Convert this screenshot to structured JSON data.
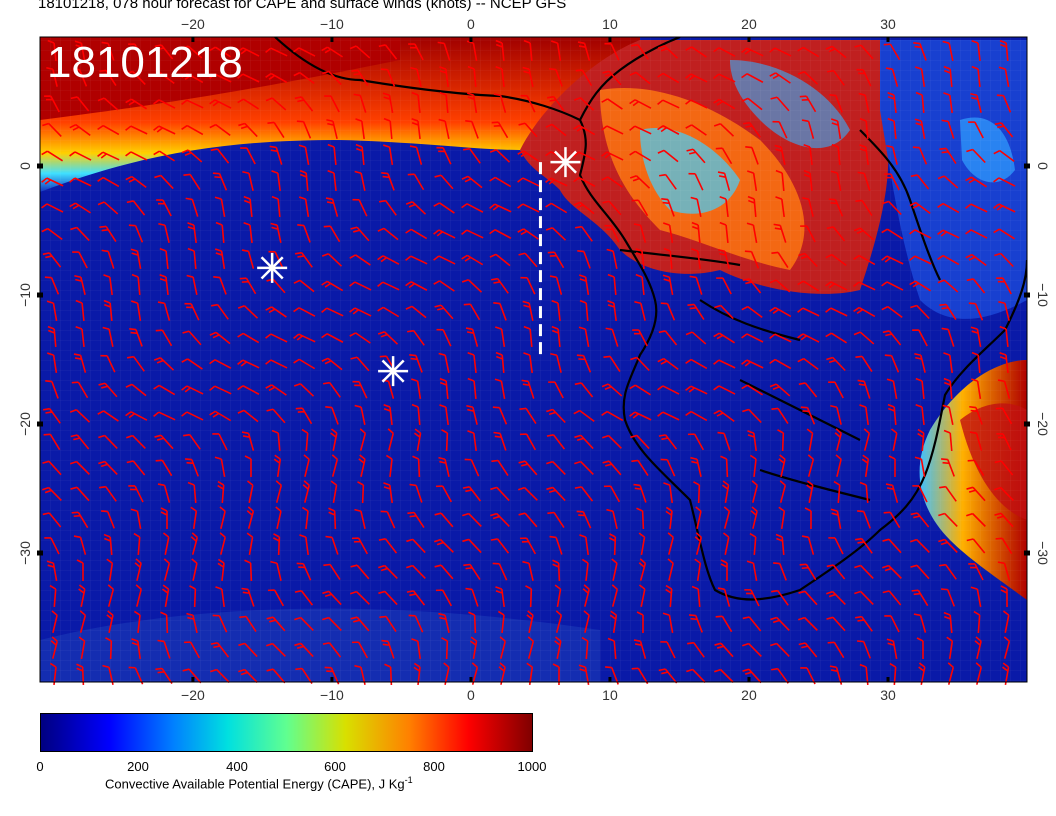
{
  "header": {
    "title": "18101218, 078 hour forecast for CAPE and surface winds (knots) -- NCEP GFS",
    "stamp": "18101218"
  },
  "map": {
    "region": "South Atlantic and southern Africa",
    "lon_range": [
      -31,
      40
    ],
    "lat_range": [
      -40,
      10
    ],
    "lon_ticks": [
      -20,
      -10,
      0,
      10,
      20,
      30
    ],
    "lon_tick_labels": [
      "−20",
      "−10",
      "0",
      "10",
      "20",
      "30"
    ],
    "lat_ticks": [
      0,
      -10,
      -20,
      -30
    ],
    "lat_tick_labels": [
      "0",
      "−10",
      "−20",
      "−30"
    ],
    "markers": [
      {
        "symbol": "asterisk",
        "lon": -14.3,
        "lat": -7.9
      },
      {
        "symbol": "asterisk",
        "lon": -5.6,
        "lat": -15.9
      },
      {
        "symbol": "asterisk",
        "lon": 6.8,
        "lat": 0.3
      }
    ],
    "dashed_track": {
      "lon": 5.0,
      "lat_from": 0.3,
      "lat_to": -15.0
    },
    "wind_barb_color": "#ff0000"
  },
  "colorbar": {
    "label": "Convective Available Potential Energy (CAPE), J Kg",
    "label_superscript": "-1",
    "tick_labels": [
      "0",
      "200",
      "400",
      "600",
      "800",
      "1000"
    ],
    "colors": [
      "#000080",
      "#0000ff",
      "#0080ff",
      "#00e0e0",
      "#60ff90",
      "#d8e000",
      "#ff8000",
      "#ff0000",
      "#800000"
    ]
  }
}
